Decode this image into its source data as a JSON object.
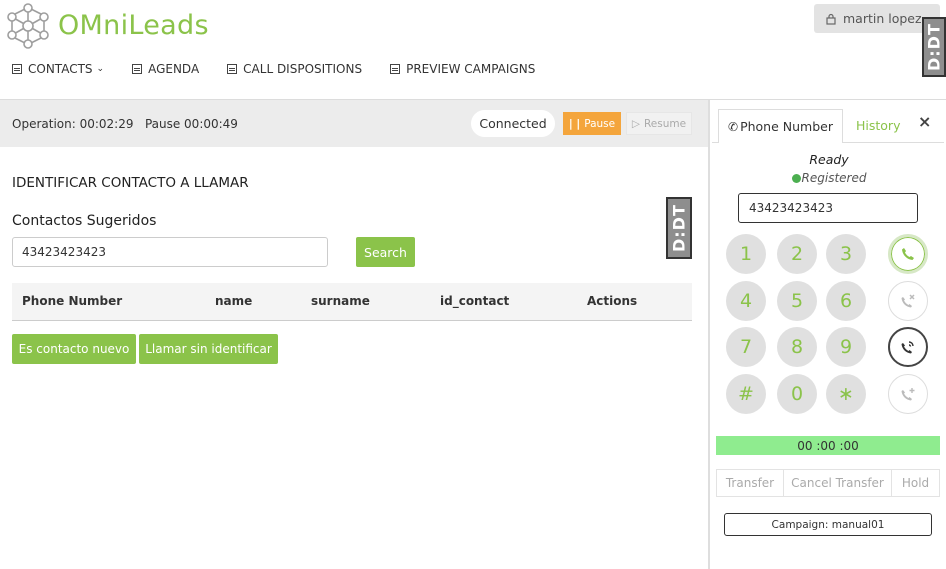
{
  "header": {
    "logo_om": "OM",
    "logo_ni": "ni",
    "logo_leads": "Leads",
    "user_name": "martin lopez",
    "ddt_badge": "D:DT"
  },
  "nav": [
    {
      "label": "CONTACTS",
      "has_dropdown": true
    },
    {
      "label": "AGENDA"
    },
    {
      "label": "CALL DISPOSITIONS"
    },
    {
      "label": "PREVIEW CAMPAIGNS"
    }
  ],
  "status": {
    "operation": "Operation: 00:02:29",
    "pause": "Pause 00:00:49",
    "connected": "Connected",
    "pause_btn": "Pause",
    "resume_btn": "Resume"
  },
  "identify": {
    "title": "IDENTIFICAR CONTACTO A LLAMAR",
    "subtitle": "Contactos Sugeridos",
    "phone_value": "43423423423",
    "search_btn": "Search",
    "columns": [
      "Phone Number",
      "name",
      "surname",
      "id_contact",
      "Actions"
    ],
    "btn_nuevo": "Es contacto nuevo",
    "btn_llamar": "Llamar sin identificar"
  },
  "phone": {
    "tab_phone": "Phone Number",
    "tab_history": "History",
    "close": "×",
    "ready": "Ready",
    "registered": "Registered",
    "dial_value": "43423423423",
    "keys": [
      "1",
      "2",
      "3",
      "4",
      "5",
      "6",
      "7",
      "8",
      "9",
      "#",
      "0",
      "∗"
    ],
    "timer": "00 :00 :00",
    "transfer": "Transfer",
    "cancel_transfer": "Cancel Transfer",
    "hold": "Hold",
    "campaign": "Campaign: manual01"
  },
  "colors": {
    "brand_green": "#8bc34a",
    "pause_orange": "#f4a53c",
    "timer_green": "#8fec8f"
  }
}
